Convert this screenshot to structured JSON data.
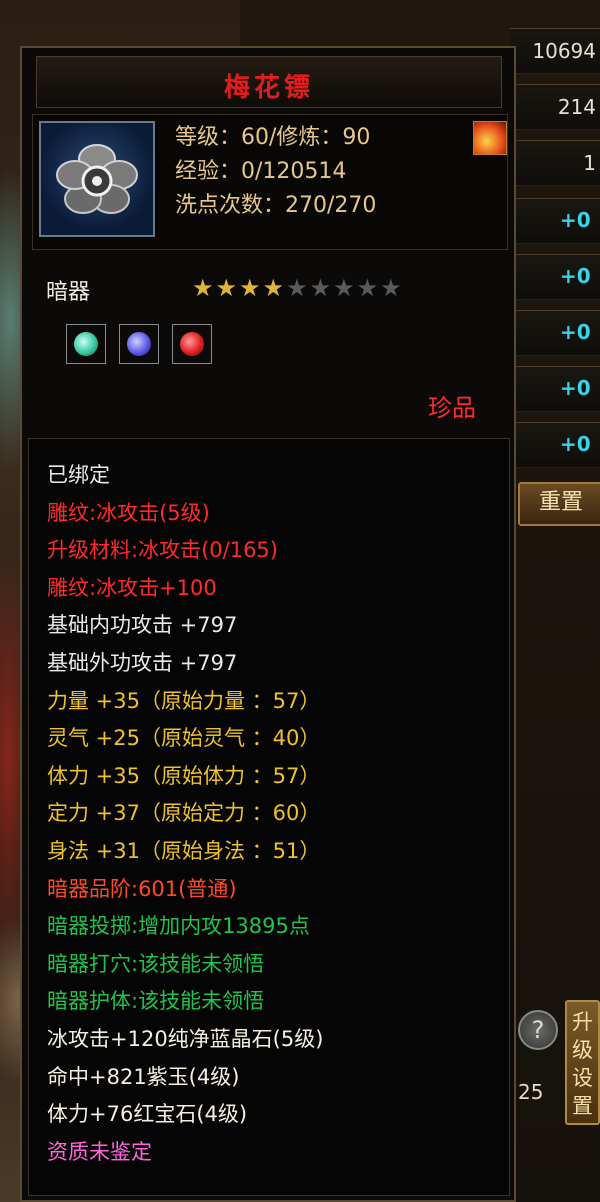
{
  "background": {
    "right_values": [
      "10694",
      "214",
      "1"
    ],
    "plus_labels": [
      "+0",
      "+0",
      "+0",
      "+0",
      "+0"
    ],
    "reset_label": "重置",
    "upgrade_label": "升级设置",
    "help_label": "?",
    "number_25": "25"
  },
  "tooltip": {
    "title": "梅花镖",
    "header": {
      "icon": "plum-blossom-dart-icon",
      "level_line": "等级：60/修炼：90",
      "exp_line": "经验：0/120514",
      "wash_line": "洗点次数：270/270",
      "badge_icon": "flame-icon"
    },
    "type_label": "暗器",
    "stars": {
      "total": 9,
      "filled": 4
    },
    "gems": [
      {
        "name": "green-gem-icon",
        "color": "#3ac8a0"
      },
      {
        "name": "blue-gem-icon",
        "color": "#5a5ae8"
      },
      {
        "name": "red-gem-icon",
        "color": "#e02020"
      }
    ],
    "rarity": "珍品",
    "attributes": [
      {
        "text": "已绑定",
        "color": "#eaeaea"
      },
      {
        "text": "雕纹:冰攻击(5级)",
        "color": "#ff2a2a"
      },
      {
        "text": "升级材料:冰攻击(0/165)",
        "color": "#ff2a2a"
      },
      {
        "text": "雕纹:冰攻击+100",
        "color": "#ff2a2a"
      },
      {
        "text": "基础内功攻击 +797",
        "color": "#eaeaea"
      },
      {
        "text": "基础外功攻击 +797",
        "color": "#eaeaea"
      },
      {
        "text": "力量 +35（原始力量 ：57）",
        "color": "#f0c22a"
      },
      {
        "text": "灵气 +25（原始灵气 ：40）",
        "color": "#f0c22a"
      },
      {
        "text": "体力 +35（原始体力 ：57）",
        "color": "#f0c22a"
      },
      {
        "text": "定力 +37（原始定力 ：60）",
        "color": "#f0c22a"
      },
      {
        "text": "身法 +31（原始身法 ：51）",
        "color": "#f0c22a"
      },
      {
        "text": "暗器品阶:601(普通)",
        "color": "#ff4a2a"
      },
      {
        "text": "暗器投掷:增加内攻13895点",
        "color": "#22c44a"
      },
      {
        "text": "暗器打穴:该技能未领悟",
        "color": "#22c44a"
      },
      {
        "text": "暗器护体:该技能未领悟",
        "color": "#22c44a"
      },
      {
        "text": "冰攻击+120纯净蓝晶石(5级)",
        "color": "#f6f0e0"
      },
      {
        "text": "命中+821紫玉(4级)",
        "color": "#f6f0e0"
      },
      {
        "text": "体力+76红宝石(4级)",
        "color": "#f6f0e0"
      },
      {
        "text": "资质未鉴定",
        "color": "#ff66dd"
      }
    ]
  }
}
